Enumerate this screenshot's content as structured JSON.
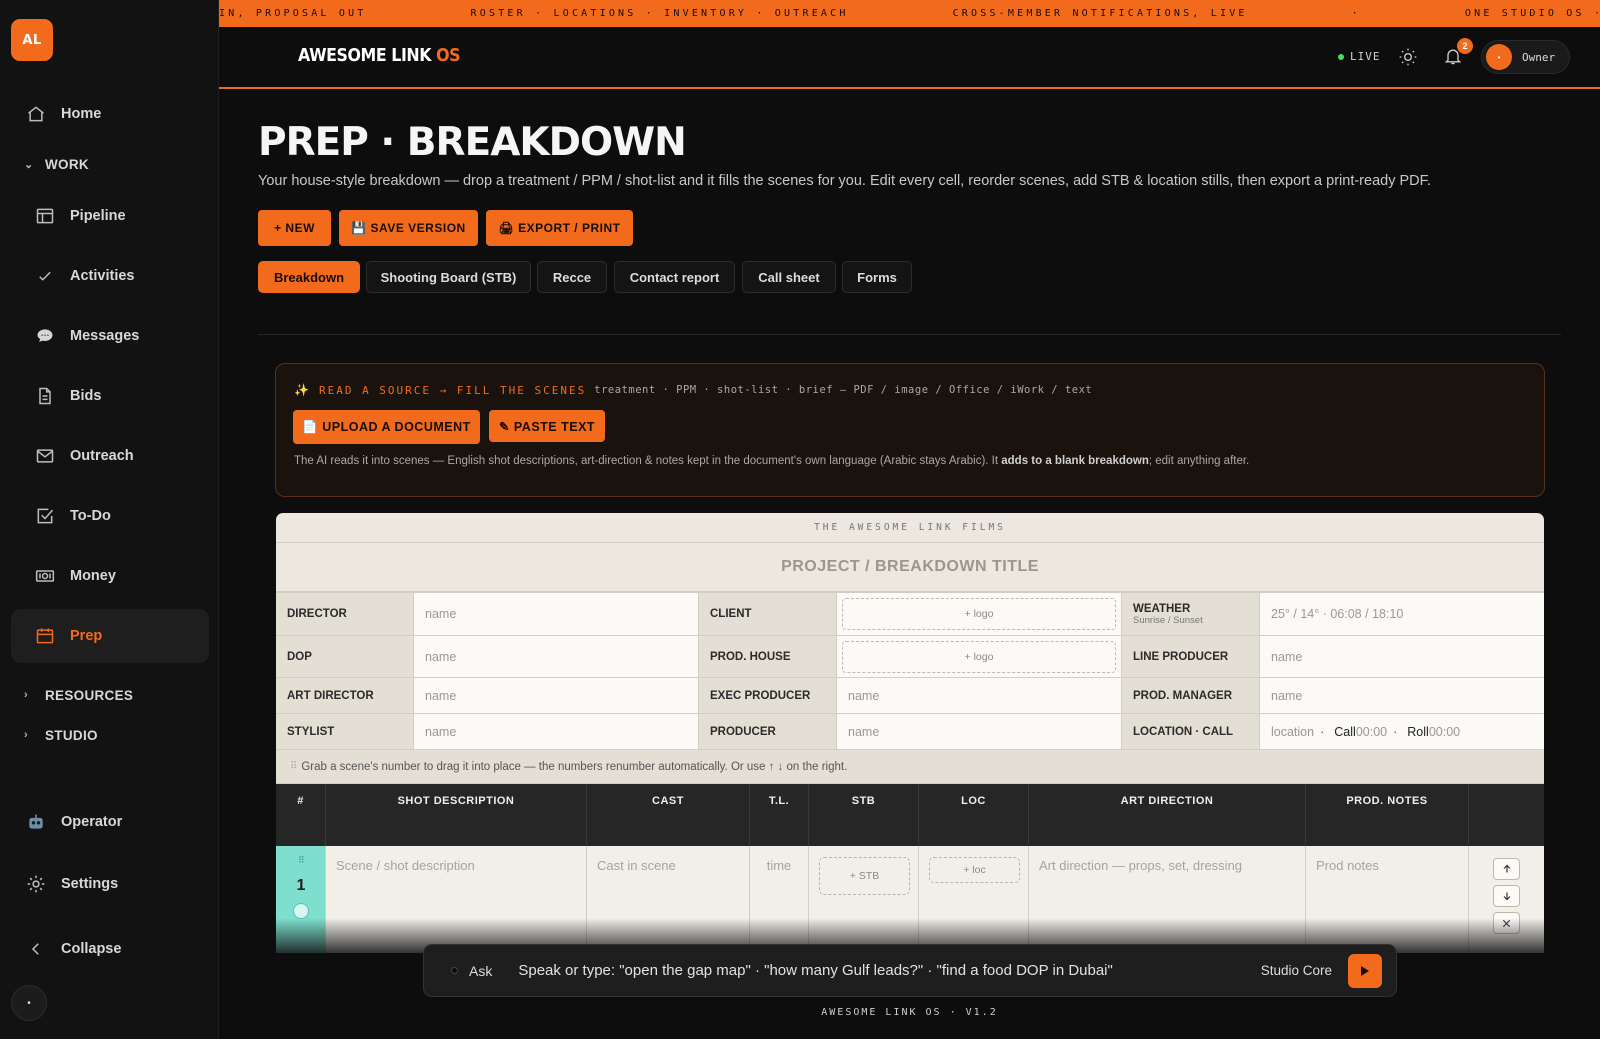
{
  "sidebar": {
    "logo": "AL",
    "items": [
      {
        "label": "Home",
        "icon": "home-icon"
      },
      {
        "label": "Pipeline",
        "icon": "table-icon"
      },
      {
        "label": "Activities",
        "icon": "check-icon"
      },
      {
        "label": "Messages",
        "icon": "chat-icon"
      },
      {
        "label": "Bids",
        "icon": "document-icon"
      },
      {
        "label": "Outreach",
        "icon": "mail-icon"
      },
      {
        "label": "To-Do",
        "icon": "checkbox-icon"
      },
      {
        "label": "Money",
        "icon": "money-icon"
      },
      {
        "label": "Prep",
        "icon": "calendar-icon",
        "active": true
      }
    ],
    "sections": {
      "work": "WORK",
      "resources": "RESOURCES",
      "studio": "STUDIO"
    },
    "operator": "Operator",
    "settings": "Settings",
    "collapse": "Collapse",
    "bottom_dot": "•"
  },
  "ticker": [
    "IN, PROPOSAL OUT",
    "ROSTER · LOCATIONS · INVENTORY · OUTREACH",
    "CROSS-MEMBER NOTIFICATIONS, LIVE",
    "·",
    "ONE STUDIO OS · EVERY MARKET"
  ],
  "topbar": {
    "brand": "AWESOME LINK",
    "brand_accent": "OS",
    "live": "LIVE",
    "notifications": "2",
    "owner_avatar": "•",
    "owner": "Owner"
  },
  "main": {
    "title": "PREP · BREAKDOWN",
    "subtitle": "Your house-style breakdown — drop a treatment / PPM / shot-list and it fills the scenes for you. Edit every cell, reorder scenes, add STB & location stills, then export a print-ready PDF.",
    "buttons": {
      "new": "+ NEW",
      "save": "💾 SAVE VERSION",
      "export": "🖨 EXPORT / PRINT"
    },
    "tabs": [
      "Breakdown",
      "Shooting Board (STB)",
      "Recce",
      "Contact report",
      "Call sheet",
      "Forms"
    ]
  },
  "ai": {
    "spark": "✨",
    "title": "READ A SOURCE → FILL THE SCENES",
    "formats": "treatment · PPM · shot-list · brief — PDF / image / Office / iWork / text",
    "upload": "📄 UPLOAD A DOCUMENT",
    "paste": "✎ PASTE TEXT",
    "note_pre": "The AI reads it into scenes — English shot descriptions, art-direction & notes kept in the document's own language (Arabic stays Arabic). It ",
    "note_bold": "adds to a blank breakdown",
    "note_post": "; edit anything after."
  },
  "sheet": {
    "company": "THE AWESOME LINK FILMS",
    "title": "PROJECT / BREAKDOWN TITLE",
    "rows": [
      {
        "l1": "DIRECTOR",
        "v1": "name",
        "l2": "CLIENT",
        "v2": "+ logo",
        "l3": "WEATHER",
        "l3sub": "Sunrise / Sunset",
        "v3": "25° / 14° · 06:08 / 18:10"
      },
      {
        "l1": "DOP",
        "v1": "name",
        "l2": "PROD. HOUSE",
        "v2": "+ logo",
        "l3": "LINE PRODUCER",
        "v3": "name"
      },
      {
        "l1": "ART DIRECTOR",
        "v1": "name",
        "l2": "EXEC PRODUCER",
        "v2": "name",
        "l3": "PROD. MANAGER",
        "v3": "name"
      },
      {
        "l1": "STYLIST",
        "v1": "name",
        "l2": "PRODUCER",
        "v2": "name",
        "l3": "LOCATION · CALL",
        "loc": "location",
        "call_label": "Call",
        "call": "00:00",
        "roll_label": "Roll",
        "roll": "00:00"
      }
    ],
    "drag_hint": "Grab a scene's number to drag it into place — the numbers renumber automatically. Or use ↑ ↓ on the right.",
    "columns": [
      "#",
      "SHOT DESCRIPTION",
      "CAST",
      "T.L.",
      "STB",
      "LOC",
      "ART DIRECTION",
      "PROD. NOTES",
      ""
    ],
    "scene": {
      "number": "1",
      "description": "Scene / shot description",
      "cast": "Cast in scene",
      "tl": "time",
      "stb": "+ STB",
      "loc": "+ loc",
      "art": "Art direction — props, set, dressing",
      "notes": "Prod notes"
    }
  },
  "ask": {
    "label": "Ask",
    "placeholder": "Speak or type: \"open the gap map\" · \"how many Gulf leads?\" · \"find a food DOP in Dubai\"",
    "model": "Studio Core"
  },
  "footer": "AWESOME LINK OS · V1.2",
  "colors": {
    "accent": "#f26b1d",
    "scene_number": "#7fdfcf",
    "live": "#4cd964"
  }
}
